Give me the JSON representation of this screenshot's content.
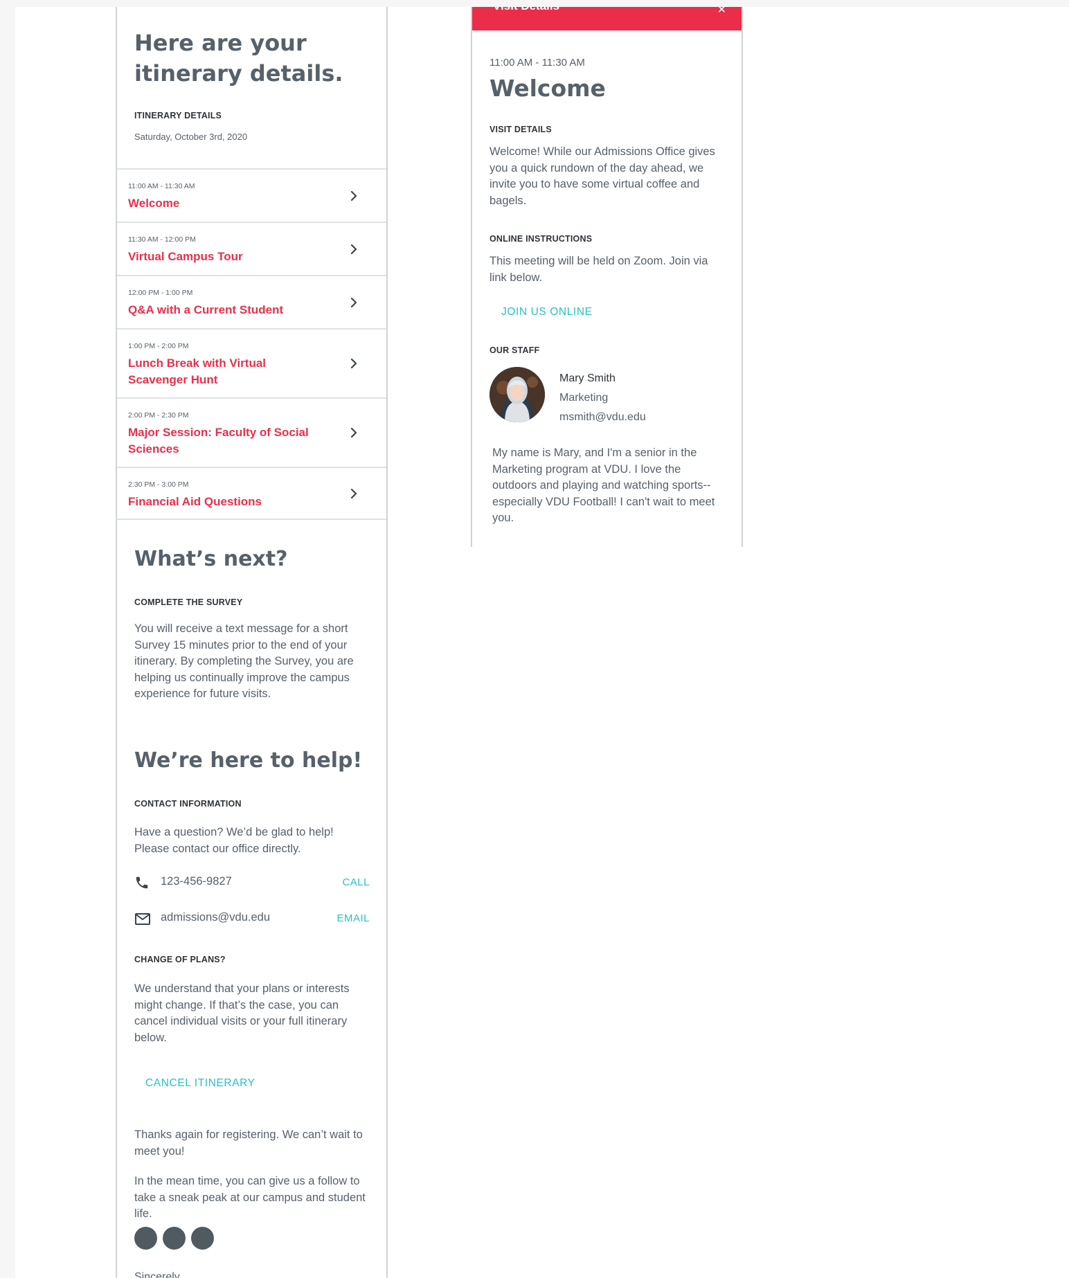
{
  "left": {
    "heading": "Here are your itinerary details.",
    "eyebrow_details": "ITINERARY DETAILS",
    "date": "Saturday, October 3rd, 2020",
    "items": [
      {
        "time": "11:00 AM - 11:30 AM",
        "title": "Welcome"
      },
      {
        "time": "11:30 AM - 12:00 PM",
        "title": "Virtual Campus Tour"
      },
      {
        "time": "12:00 PM - 1:00 PM",
        "title": "Q&A with a Current Student"
      },
      {
        "time": "1:00 PM - 2:00 PM",
        "title": "Lunch Break with Virtual Scavenger Hunt"
      },
      {
        "time": "2:00 PM - 2:30 PM",
        "title": "Major Session: Faculty of Social Sciences"
      },
      {
        "time": "2:30 PM - 3:00 PM",
        "title": "Financial Aid Questions"
      }
    ],
    "whats_next": {
      "heading": "What’s next?",
      "eyebrow": "COMPLETE THE SURVEY",
      "text": "You will receive a text message for a short Survey 15 minutes prior to the end of your itinerary. By completing the Survey, you are helping us continually improve the campus experience for future visits."
    },
    "help": {
      "heading": "We’re here to help!",
      "eyebrow": "CONTACT INFORMATION",
      "text": "Have a question? We’d be glad to help! Please contact our office directly.",
      "phone": "123-456-9827",
      "call_label": "CALL",
      "email": "admissions@vdu.edu",
      "email_label": "EMAIL"
    },
    "change": {
      "eyebrow": "CHANGE OF PLANS?",
      "text": "We understand that your plans or interests might change. If that’s the case, you can cancel individual visits or your full itinerary below.",
      "cancel_label": "CANCEL ITINERARY"
    },
    "thanks": "Thanks again for registering. We can’t wait to meet you!",
    "follow": "In the mean time, you can give us a follow to take a sneak peak at our campus and student life.",
    "sincerely": "Sincerely"
  },
  "right": {
    "header_title": "Visit Details",
    "time": "11:00 AM - 11:30 AM",
    "heading": "Welcome",
    "visit_eyebrow": "VISIT DETAILS",
    "visit_text": "Welcome! While our Admissions Office gives you a quick rundown of the day ahead, we invite you to have some virtual coffee and bagels.",
    "online_eyebrow": "ONLINE INSTRUCTIONS",
    "online_text": "This meeting will be held on Zoom. Join via link below.",
    "join_label": "JOIN US ONLINE",
    "staff_eyebrow": "OUR STAFF",
    "staff_name": "Mary Smith",
    "staff_dept": "Marketing",
    "staff_email": "msmith@vdu.edu",
    "staff_bio": "My name is Mary, and I'm a senior in the Marketing program at VDU. I love the outdoors and playing and watching sports--especially VDU Football! I can't wait to meet you."
  },
  "colors": {
    "accent_red": "#e8304b",
    "link_teal": "#27c1c9",
    "text_gray": "#56616a"
  }
}
